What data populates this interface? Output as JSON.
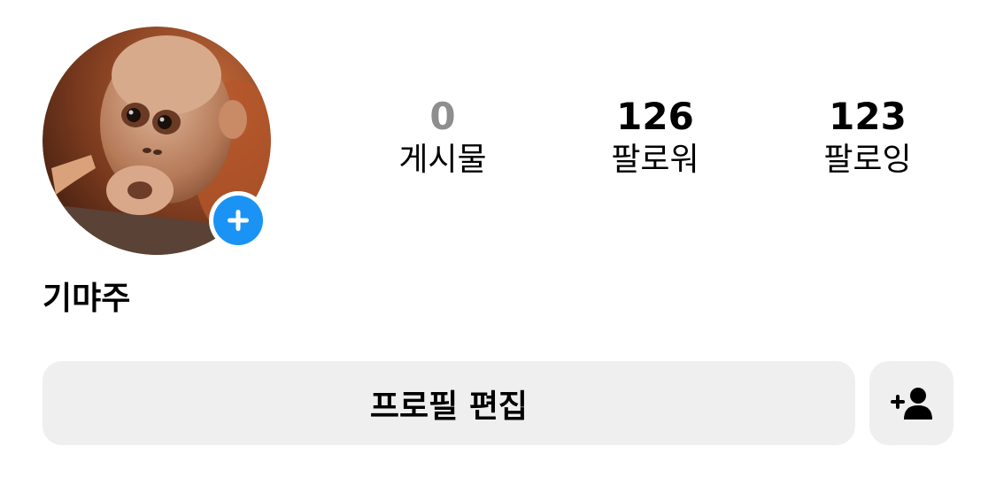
{
  "profile": {
    "username": "기먀주",
    "avatar_alt": "avatar"
  },
  "stats": {
    "posts": {
      "count": "0",
      "label": "게시물"
    },
    "followers": {
      "count": "126",
      "label": "팔로워"
    },
    "following": {
      "count": "123",
      "label": "팔로잉"
    }
  },
  "actions": {
    "edit_profile_label": "프로필 편집",
    "add_story_icon": "plus-icon",
    "discover_people_icon": "add-person-icon"
  },
  "colors": {
    "accent_blue": "#1a93f5",
    "button_bg": "#efefef",
    "muted_text": "#8e8e8e"
  }
}
